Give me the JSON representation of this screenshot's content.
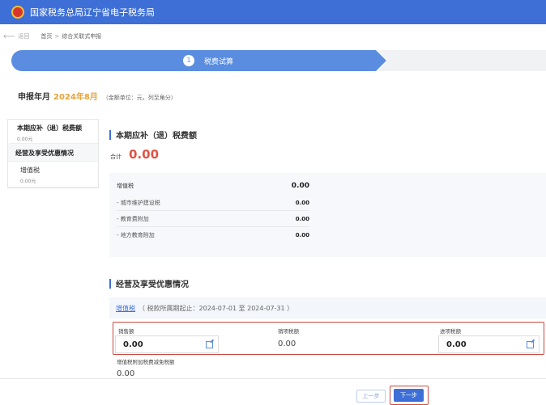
{
  "header": {
    "title": "国家税务总局辽宁省电子税务局"
  },
  "breadcrumb": {
    "back_label": "返回",
    "home": "首页",
    "separator": ">",
    "current": "综合关联式申报"
  },
  "stepper": {
    "step_number": "1",
    "step_label": "税费试算"
  },
  "period": {
    "label": "申报年月",
    "value": "2024年8月",
    "note": "（金额单位：元，列至角分）"
  },
  "sidebar": {
    "items": [
      {
        "label": "本期应补（退）税费额",
        "value": "0.00元"
      },
      {
        "label": "经营及享受优惠情况"
      },
      {
        "label": "增值税",
        "value": "0.00元"
      }
    ]
  },
  "section1": {
    "title": "本期应补（退）税费额",
    "total_label": "合计",
    "total_value": "0.00",
    "main_tax": {
      "name": "增值税",
      "value": "0.00"
    },
    "sub_taxes": [
      {
        "name": "- 城市维护建设税",
        "value": "0.00"
      },
      {
        "name": "- 教育费附加",
        "value": "0.00"
      },
      {
        "name": "- 地方教育附加",
        "value": "0.00"
      }
    ]
  },
  "section2": {
    "title": "经营及享受优惠情况",
    "vat_link": "增值税",
    "vat_period": "（ 税款所属期起止：2024-07-01 至 2024-07-31 ）",
    "fields": {
      "sales": {
        "label": "销售额",
        "value": "0.00"
      },
      "output": {
        "label": "销项税额",
        "value": "0.00"
      },
      "input": {
        "label": "进项税额",
        "value": "0.00"
      }
    },
    "surcharge": {
      "label": "增值税附加税费减免税额",
      "value": "0.00"
    }
  },
  "footer": {
    "prev_label": "上一步",
    "next_label": "下一步"
  },
  "colors": {
    "brand_blue": "#3d6fd6",
    "step_blue": "#5a8de0",
    "total_red": "#e05246",
    "highlight_box": "#c94a40",
    "period_orange": "#e8a23a"
  }
}
